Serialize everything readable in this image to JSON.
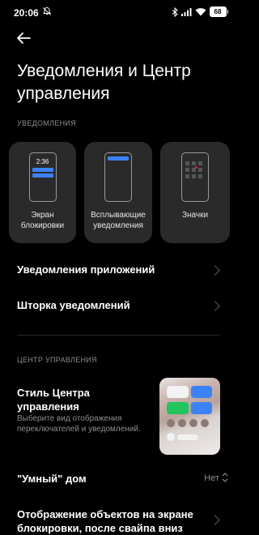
{
  "status_bar": {
    "time": "20:06",
    "battery": "68",
    "icons": [
      "bell-off-icon",
      "bluetooth-icon",
      "signal-icon",
      "wifi-icon",
      "battery-icon"
    ]
  },
  "header": {
    "back_icon": "arrow-left-icon",
    "title": "Уведомления и Центр управления"
  },
  "notifications_section": {
    "label": "УВЕДОМЛЕНИЯ",
    "cards": [
      {
        "label": "Экран блокировки",
        "preview_time": "2:36"
      },
      {
        "label": "Всплывающие уведомления"
      },
      {
        "label": "Значки"
      }
    ],
    "rows": [
      {
        "label": "Уведомления приложений"
      },
      {
        "label": "Шторка уведомлений"
      }
    ]
  },
  "control_center_section": {
    "label": "ЦЕНТР УПРАВЛЕНИЯ",
    "style": {
      "title": "Стиль Центра управления",
      "description": "Выберите вид отображения переключателей и уведомлений."
    },
    "smart_home": {
      "label": "\"Умный\" дом",
      "value": "Нет"
    },
    "lockscreen_items": {
      "label": "Отображение объектов на экране блокировки, после свайпа вниз"
    }
  },
  "colors": {
    "background": "#000000",
    "card": "#2a2a2a",
    "accent_blue": "#3b82f6",
    "accent_green": "#22c55e",
    "secondary_text": "#8e8e8e"
  }
}
